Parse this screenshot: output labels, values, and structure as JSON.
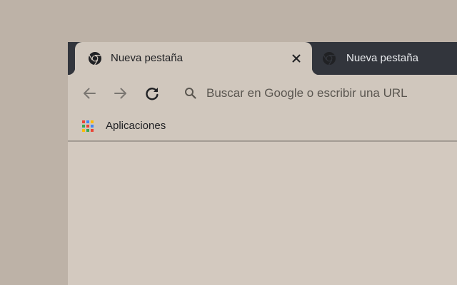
{
  "theme": {
    "desktop_bg": "#bdb2a7",
    "tabstrip_bg": "#32353c",
    "tab_active_bg": "#d0c7bd",
    "toolbar_bg": "#d0c7bd",
    "content_bg": "#d3c9bf",
    "divider": "#a39b93",
    "text_active": "#202124",
    "text_inactive": "#e8eaed",
    "icon_disabled": "#7a7671",
    "icon_active": "#202124",
    "placeholder": "#5a5650"
  },
  "tabs": [
    {
      "title": "Nueva pestaña",
      "active": true,
      "favicon": "chrome-logo-icon",
      "close_icon": "close-icon"
    },
    {
      "title": "Nueva pestaña",
      "active": false,
      "favicon": "chrome-logo-icon"
    }
  ],
  "toolbar": {
    "back_icon": "arrow-back-icon",
    "forward_icon": "arrow-forward-icon",
    "reload_icon": "reload-icon",
    "omnibox": {
      "search_icon": "search-icon",
      "value": "",
      "placeholder": "Buscar en Google o escribir una URL"
    }
  },
  "bookmarks": [
    {
      "label": "Aplicaciones",
      "icon": "apps-grid-icon",
      "icon_colors": [
        "#ea4335",
        "#4285f4",
        "#fbbc05",
        "#34a853",
        "#ea4335",
        "#4285f4",
        "#fbbc05",
        "#34a853",
        "#ea4335"
      ]
    }
  ]
}
